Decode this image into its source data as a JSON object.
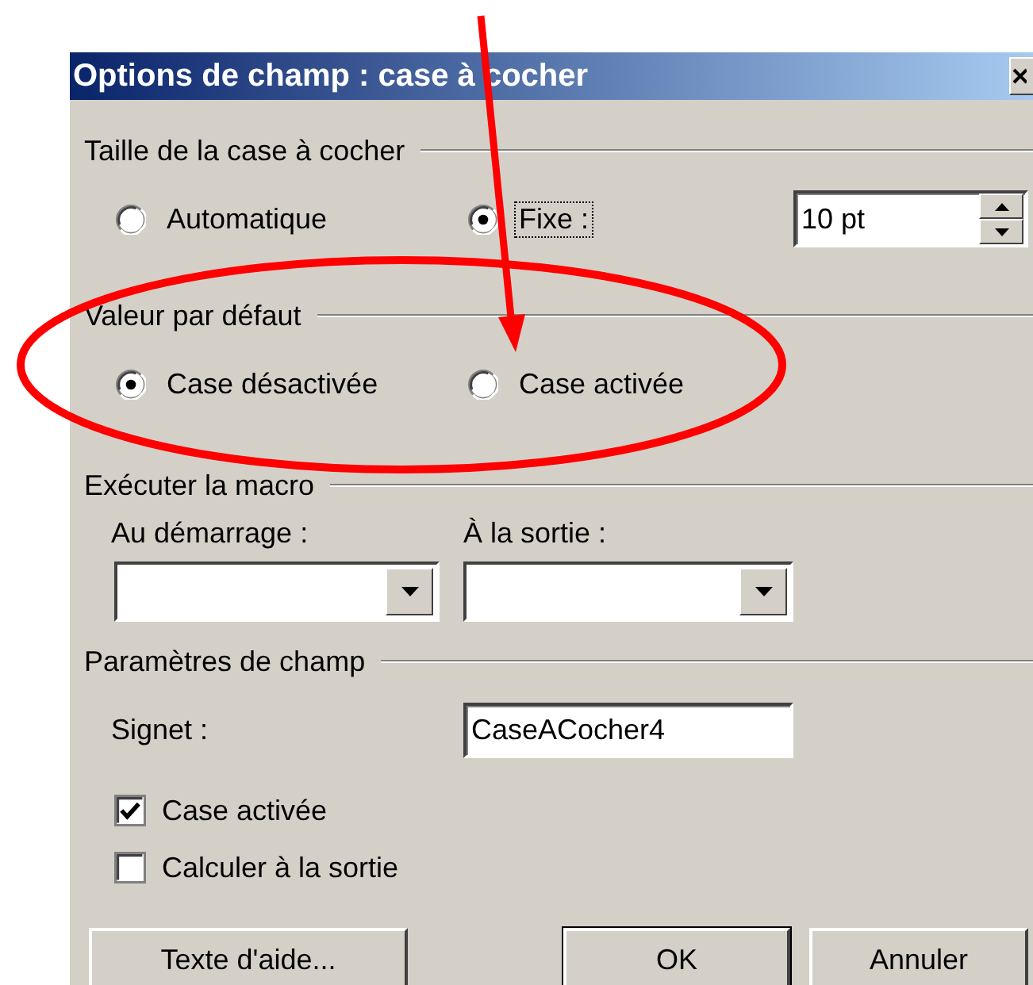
{
  "window": {
    "title": "Options de champ : case à cocher"
  },
  "checkbox_size": {
    "label": "Taille de la case à cocher",
    "options": [
      {
        "label": "Automatique",
        "selected": false,
        "focused": false
      },
      {
        "label": "Fixe :",
        "selected": true,
        "focused": true
      }
    ],
    "size_field": {
      "value": "10 pt"
    }
  },
  "default_value": {
    "label": "Valeur par défaut",
    "options": [
      {
        "label": "Case désactivée",
        "selected": true,
        "focused": false
      },
      {
        "label": "Case activée",
        "selected": false,
        "focused": false
      }
    ]
  },
  "run_macro": {
    "label": "Exécuter la macro",
    "on_entry": {
      "label": "Au démarrage :"
    },
    "on_exit": {
      "label": "À la sortie :"
    }
  },
  "field_settings": {
    "label": "Paramètres de champ",
    "bookmark": {
      "label": "Signet :",
      "value": "CaseACocher4"
    },
    "checkboxes": [
      {
        "label": "Case activée",
        "checked": true
      },
      {
        "label": "Calculer à la sortie",
        "checked": false
      }
    ]
  },
  "buttons": [
    {
      "label": "Texte d'aide...",
      "default": false
    },
    {
      "label": "OK",
      "default": true
    },
    {
      "label": "Annuler",
      "default": false
    }
  ]
}
